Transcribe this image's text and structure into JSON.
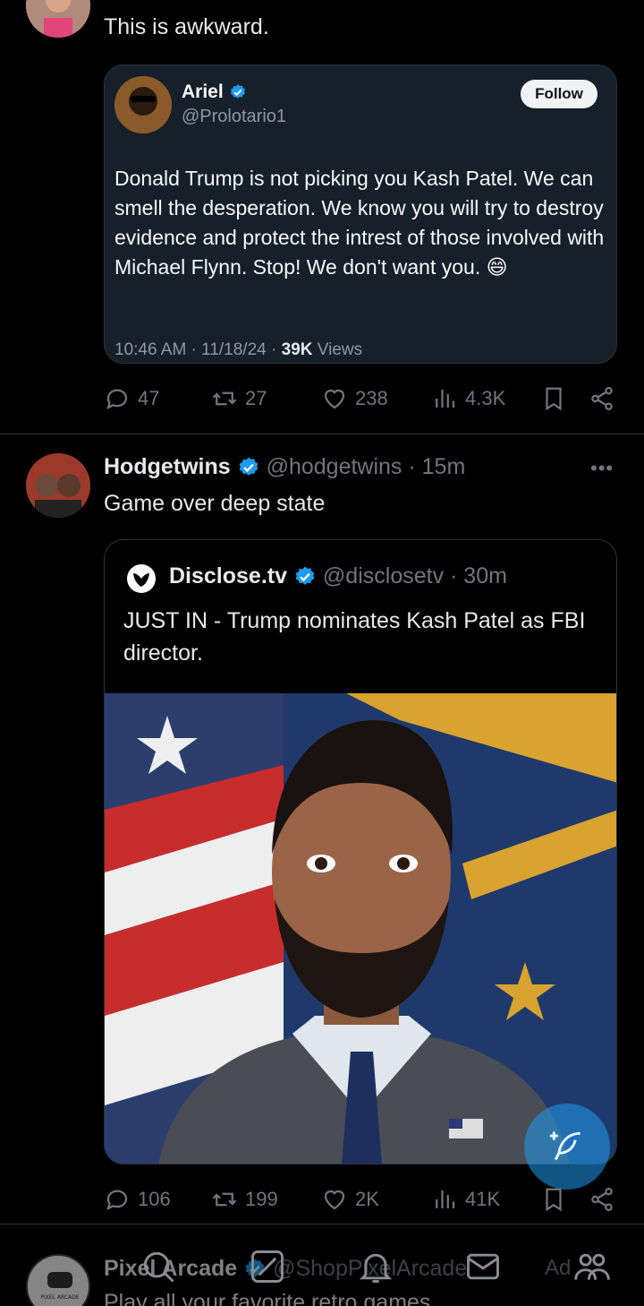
{
  "tweet1": {
    "text": "This is awkward.",
    "quoted": {
      "name": "Ariel",
      "handle": "@Prolotario1",
      "follow_label": "Follow",
      "body": "Donald Trump is not picking you Kash Patel. We can smell the desperation. We know you will try to destroy evidence and protect the intrest of those involved with Michael Flynn. Stop! We don't want you. 😄",
      "time": "10:46 AM",
      "date": "11/18/24",
      "views_count": "39K",
      "views_label": "Views"
    },
    "actions": {
      "replies": "47",
      "reposts": "27",
      "likes": "238",
      "views": "4.3K"
    }
  },
  "tweet2": {
    "name": "Hodgetwins",
    "handle": "@hodgetwins",
    "time": "15m",
    "more": "•••",
    "text": "Game over deep state",
    "quoted": {
      "name": "Disclose.tv",
      "handle": "@disclosetv",
      "time": "30m",
      "body": "JUST IN - Trump nominates Kash Patel as FBI director."
    },
    "actions": {
      "replies": "106",
      "reposts": "199",
      "likes": "2K",
      "views": "41K"
    }
  },
  "tweet3": {
    "name": "Pixel Arcade",
    "handle": "@ShopPixelArcade",
    "ad_label": "Ad",
    "text": "Play all your favorite retro games",
    "avatar_text": "PIXEL ARCADE"
  },
  "separator": " · ",
  "colors": {
    "accent": "#1d9bf0",
    "background": "#000000",
    "card": "#15202b",
    "muted": "#71767b"
  }
}
